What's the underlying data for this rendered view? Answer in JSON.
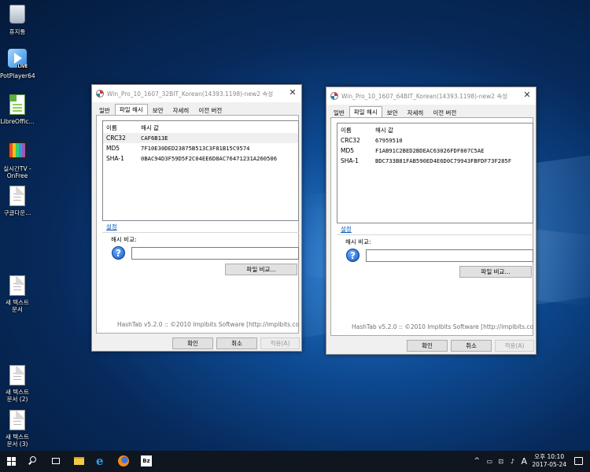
{
  "desktop": {
    "icons": [
      {
        "label": "휴지통"
      },
      {
        "label": "PotPlayer64",
        "badge": "LIVE"
      },
      {
        "label": "LibreOffic..."
      },
      {
        "label": "실시간TV -\nOnFree"
      },
      {
        "label": "구글다운..."
      },
      {
        "label": "새 텍스트\n문서"
      },
      {
        "label": "새 텍스트\n문서 (2)"
      },
      {
        "label": "새 텍스트\n문서 (3)"
      }
    ]
  },
  "windows": [
    {
      "title": "Win_Pro_10_1607_32BIT_Korean(14393.1198)-new2 속성",
      "close": "✕",
      "tabs": [
        "일반",
        "파일 해시",
        "보안",
        "자세히",
        "이전 버전"
      ],
      "active_tab": 1,
      "hash_header": {
        "name": "이름",
        "value": "해시 값"
      },
      "hashes": [
        {
          "name": "CRC32",
          "value": "CAF6B13E"
        },
        {
          "name": "MD5",
          "value": "7F10E30DED23875B513C3F81B15C9574"
        },
        {
          "name": "SHA-1",
          "value": "0BAC94D3F59D5F2C04EE6D8AC76471231A260506"
        }
      ],
      "settings_link": "설정",
      "compare_label": "해시 비교:",
      "compare_value": "",
      "compare_file_button": "파일 비교...",
      "credit": "HashTab v5.2.0 :: ©2010 Implbits Software [http://implbits.co",
      "buttons": {
        "ok": "확인",
        "cancel": "취소",
        "apply": "적용(A)"
      }
    },
    {
      "title": "Win_Pro_10_1607_64BIT_Korean(14393.1198)-new2 속성",
      "close": "✕",
      "tabs": [
        "일반",
        "파일 해시",
        "보안",
        "자세히",
        "이전 버전"
      ],
      "active_tab": 1,
      "hash_header": {
        "name": "이름",
        "value": "해시 값"
      },
      "hashes": [
        {
          "name": "CRC32",
          "value": "67959510"
        },
        {
          "name": "MD5",
          "value": "F1AB91C2BED2BDEAC63026FDF807C5AE"
        },
        {
          "name": "SHA-1",
          "value": "BDC733B81FAB590ED4E6D0C79943FBFDF73F285F"
        }
      ],
      "settings_link": "설정",
      "compare_label": "해시 비교:",
      "compare_value": "",
      "compare_file_button": "파일 비교...",
      "credit": "HashTab v5.2.0 :: ©2010 Implbits Software [http://implbits.co",
      "buttons": {
        "ok": "확인",
        "cancel": "취소",
        "apply": "적용(A)"
      }
    }
  ],
  "taskbar": {
    "apps": [
      "start-icon",
      "search-icon",
      "task-view-icon",
      "file-explorer-icon",
      "internet-explorer-icon",
      "firefox-icon",
      "bandizip-icon"
    ],
    "tray": {
      "chevron": "^",
      "ime": "A"
    },
    "clock": {
      "time": "오후 10:10",
      "date": "2017-05-24"
    }
  }
}
